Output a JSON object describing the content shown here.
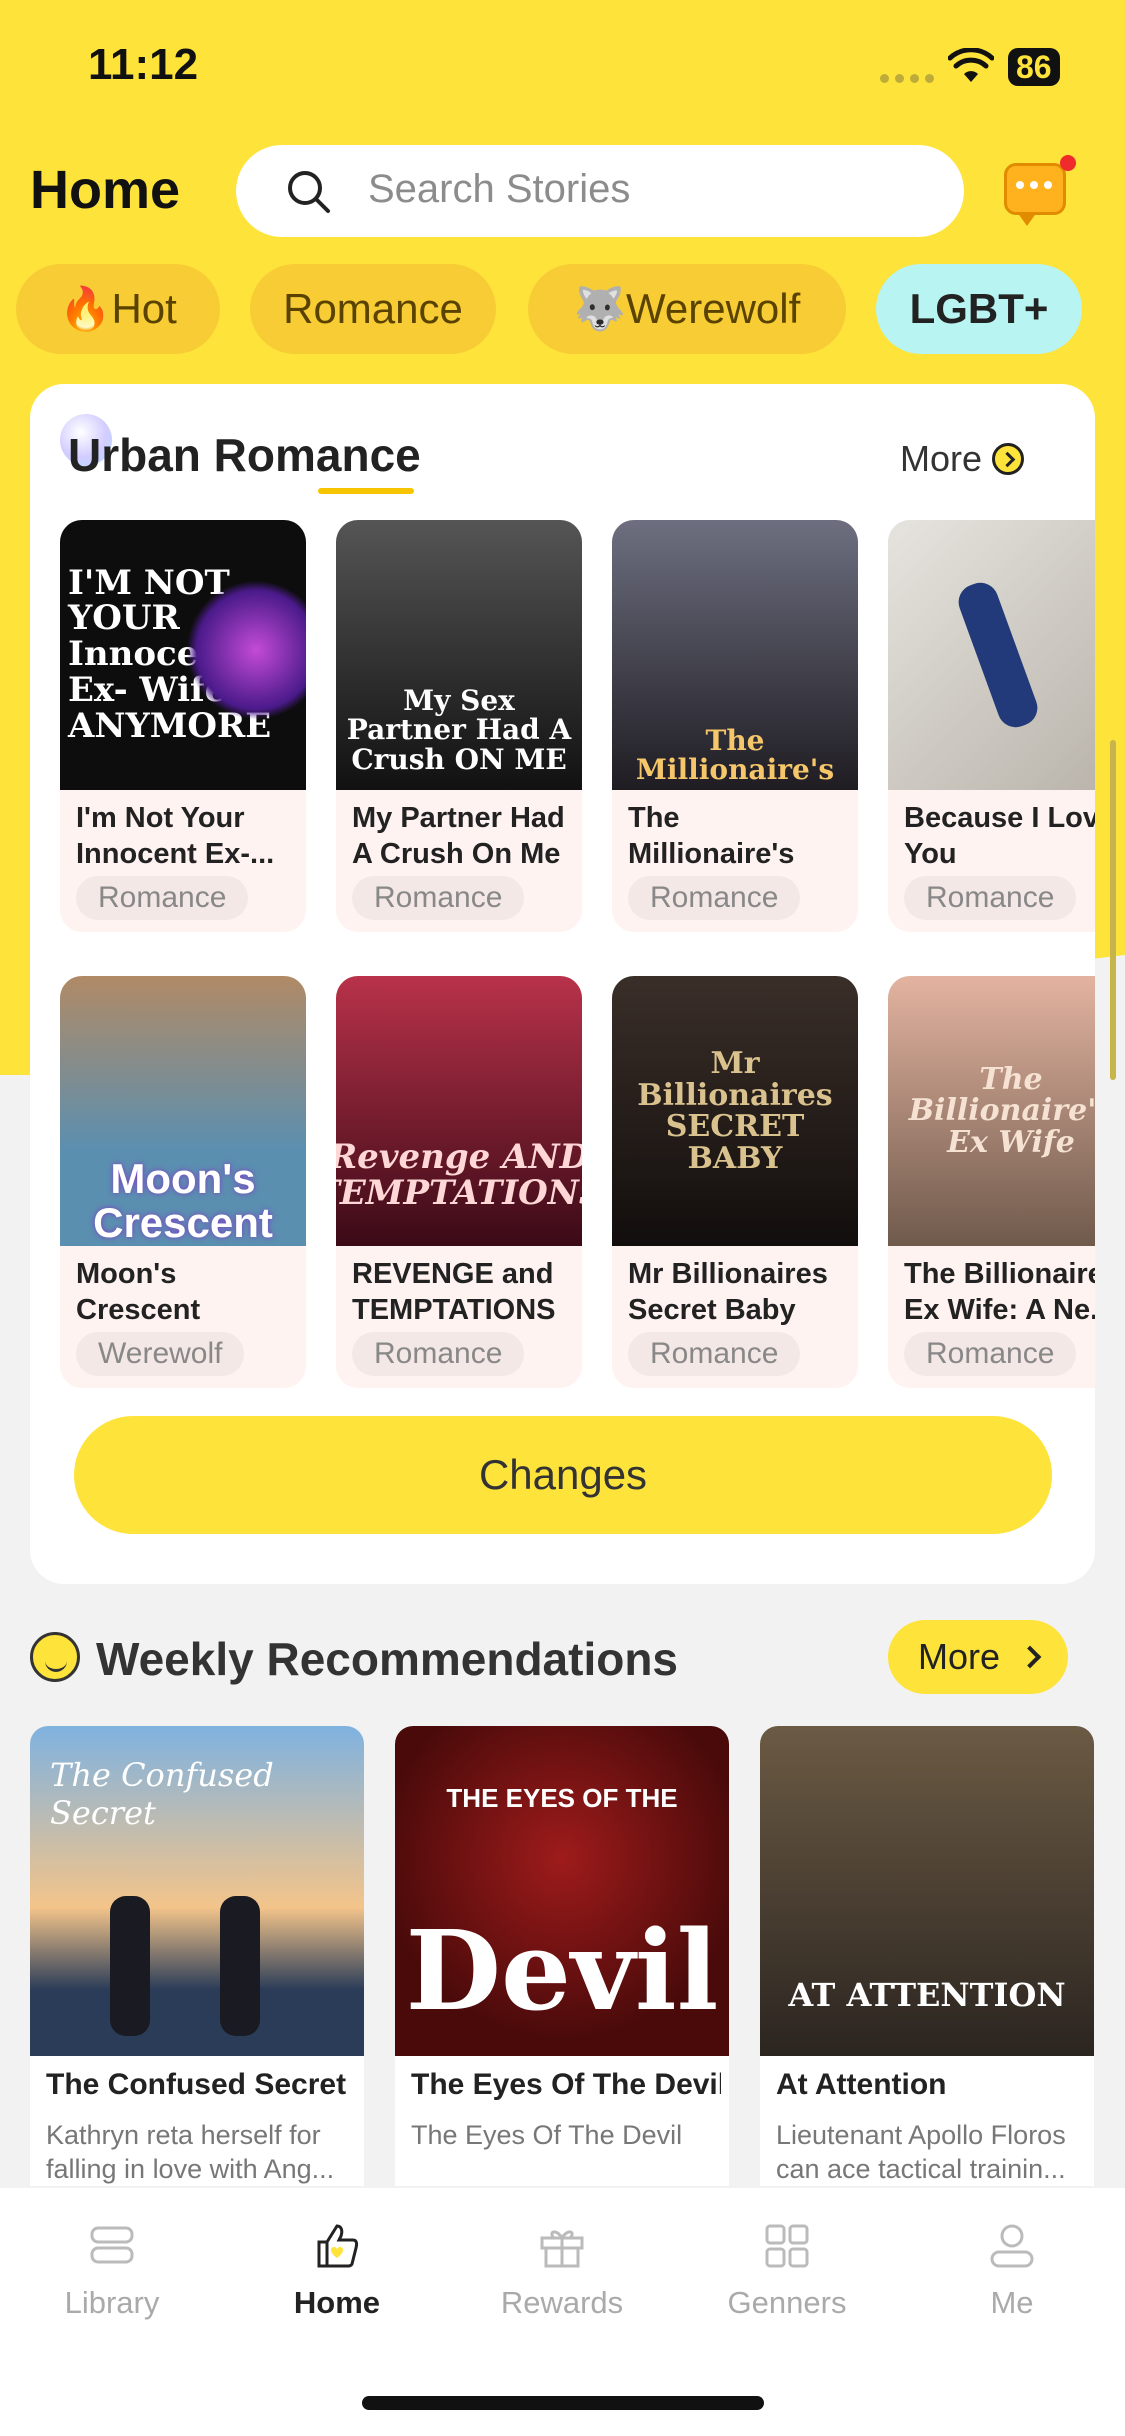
{
  "status_bar": {
    "time": "11:12",
    "battery": "86"
  },
  "header": {
    "title": "Home",
    "search_placeholder": "Search Stories"
  },
  "categories": [
    {
      "label": "🔥Hot",
      "active": false
    },
    {
      "label": "Romance",
      "active": false
    },
    {
      "label": "🐺Werewolf",
      "active": false
    },
    {
      "label": "LGBT+",
      "active": true
    }
  ],
  "urban_romance": {
    "title": "Urban Romance",
    "more_label": "More",
    "books": [
      {
        "title": "I'm Not Your Innocent Ex-...",
        "genre": "Romance",
        "cover_text": "I'M NOT YOUR Innocent Ex- Wife ANYMORE",
        "cover_color": "#0d0d0d"
      },
      {
        "title": "My Partner Had A Crush On Me",
        "genre": "Romance",
        "cover_text": "My Sex Partner Had A Crush ON ME",
        "cover_color": "#2a2a2a"
      },
      {
        "title": "The Millionaire's G...",
        "genre": "Romance",
        "cover_text": "The Millionaire's",
        "cover_color": "#3d3a44"
      },
      {
        "title": "Because I Love You",
        "genre": "Romance",
        "cover_text": "",
        "cover_color": "#d9d5cf"
      },
      {
        "title": "Moon's Crescent",
        "genre": "Werewolf",
        "cover_text": "Moon's Crescent",
        "cover_color": "#5b8fb0"
      },
      {
        "title": "REVENGE and TEMPTATIONS",
        "genre": "Romance",
        "cover_text": "Revenge AND TEMPTATIONS",
        "cover_color": "#7a1830"
      },
      {
        "title": "Mr Billionaires Secret Baby",
        "genre": "Romance",
        "cover_text": "Mr Billionaires SECRET BABY",
        "cover_color": "#1c1816"
      },
      {
        "title": "The Billionaire Ex Wife: A Ne...",
        "genre": "Romance",
        "cover_text": "The Billionaire's Ex Wife",
        "cover_color": "#b79a88"
      }
    ],
    "changes_label": "Changes"
  },
  "weekly": {
    "title": "Weekly Recommendations",
    "more_label": "More",
    "books": [
      {
        "title": "The Confused Secret",
        "desc": "Kathryn reta herself for falling in love with Ang...",
        "cover_text": "The Confused Secret"
      },
      {
        "title": "The Eyes Of The Devil",
        "desc": "The Eyes Of The Devil",
        "cover_text_top": "THE EYES OF THE",
        "cover_text_big": "Devil"
      },
      {
        "title": "At Attention",
        "desc": "Lieutenant Apollo Floros can ace tactical trainin...",
        "cover_text": "AT ATTENTION"
      }
    ]
  },
  "tabbar": [
    {
      "label": "Library",
      "icon": "library-icon",
      "active": false
    },
    {
      "label": "Home",
      "icon": "home-thumb-icon",
      "active": true
    },
    {
      "label": "Rewards",
      "icon": "gift-icon",
      "active": false
    },
    {
      "label": "Genners",
      "icon": "grid-icon",
      "active": false
    },
    {
      "label": "Me",
      "icon": "person-icon",
      "active": false
    }
  ],
  "colors": {
    "brand_yellow": "#fde33a",
    "chip_yellow": "#f8cc34",
    "chip_active": "#b8f4f2",
    "tag_bg": "#f4e8e6"
  }
}
